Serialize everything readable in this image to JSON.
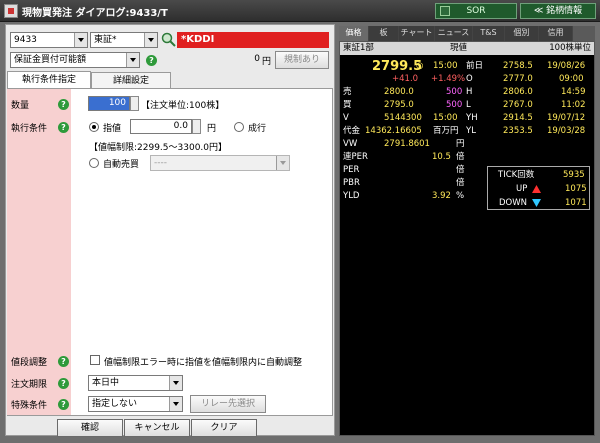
{
  "window": {
    "title": "現物買発注 ダイアログ:9433/T",
    "sor_label": "SOR",
    "meigara_label": "≪ 銘柄情報"
  },
  "order": {
    "code": "9433",
    "market": "東証*",
    "stock_name": "*KDDI",
    "account": "保証金買付可能額",
    "balance": "0",
    "balance_unit": "円",
    "regulation_btn": "規制あり",
    "tabs": [
      "執行条件指定",
      "詳細設定"
    ],
    "qty_label": "数量",
    "qty_value": "100",
    "qty_unit_note": "【注文単位:100株】",
    "cond_label": "執行条件",
    "limit_label": "指値",
    "limit_value": "0.0",
    "limit_unit": "円",
    "market_label": "成行",
    "price_range": "【値幅制限:2299.5〜3300.0円】",
    "auto_label": "自動売買",
    "auto_value": "----",
    "range_adj_label": "値段調整",
    "range_adj_text": "値幅制限エラー時に指値を値幅制限内に自動調整",
    "period_label": "注文期限",
    "period_value": "本日中",
    "special_label": "特殊条件",
    "special_value": "指定しない",
    "relay_btn": "リレー先選択"
  },
  "buttons": {
    "confirm": "確認",
    "cancel": "キャンセル",
    "clear": "クリア"
  },
  "quote": {
    "tabs": [
      "価格",
      "板",
      "チャート",
      "ニュース",
      "T&S",
      "個別",
      "信用"
    ],
    "exchange": "東証1部",
    "price_label": "現値",
    "unit_label": "100株単位",
    "price": "2799.5",
    "price_mark": "○",
    "time": "15:00",
    "prev_label": "前日",
    "prev_price": "2758.5",
    "prev_date": "19/08/26",
    "change": "+41.0",
    "change_pct": "+1.49%",
    "open_label": "O",
    "open_price": "2777.0",
    "open_time": "09:00",
    "sell_label": "売",
    "sell_price": "2800.0",
    "sell_qty": "500",
    "high_label": "H",
    "high_price": "2806.0",
    "high_time": "14:59",
    "buy_label": "買",
    "buy_price": "2795.0",
    "buy_qty": "500",
    "low_label": "L",
    "low_price": "2767.0",
    "low_time": "11:02",
    "v_label": "V",
    "v_value": "5144300",
    "v_time": "15:00",
    "yh_label": "YH",
    "yh_price": "2914.5",
    "yh_date": "19/07/12",
    "amount_label": "代金",
    "amount_value": "14362.16605",
    "amount_unit": "百万円",
    "yl_label": "YL",
    "yl_price": "2353.5",
    "yl_date": "19/03/28",
    "vw_label": "VW",
    "vw_value": "2791.8601",
    "vw_unit": "円",
    "rper_label": "連PER",
    "rper_value": "10.5",
    "rper_unit": "倍",
    "per_label": "PER",
    "per_unit": "倍",
    "pbr_label": "PBR",
    "pbr_unit": "倍",
    "yld_label": "YLD",
    "yld_value": "3.92",
    "yld_unit": "%",
    "tick_label": "TICK回数",
    "tick_value": "5935",
    "up_label": "UP",
    "up_value": "1075",
    "down_label": "DOWN",
    "down_value": "1071"
  }
}
